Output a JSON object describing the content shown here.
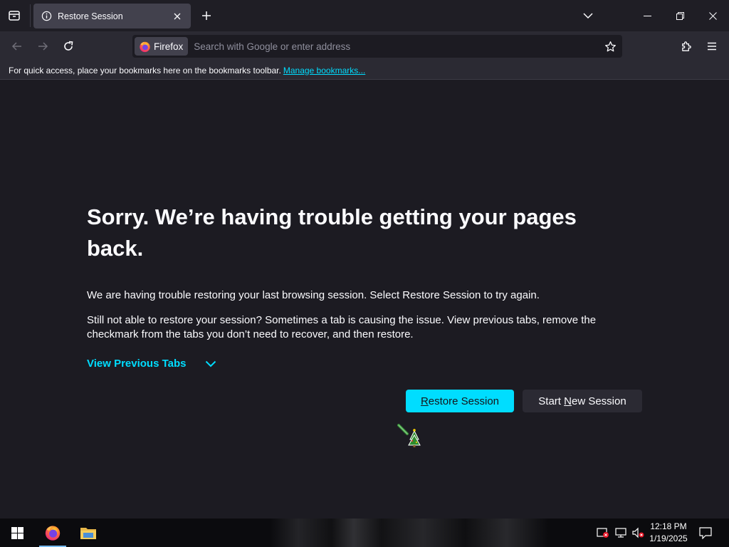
{
  "tab": {
    "title": "Restore Session",
    "icon": "info-icon"
  },
  "navbar": {
    "identity_label": "Firefox",
    "url_placeholder": "Search with Google or enter address",
    "url_value": ""
  },
  "bookmarks_bar": {
    "text": "For quick access, place your bookmarks here on the bookmarks toolbar.",
    "link": "Manage bookmarks..."
  },
  "page": {
    "heading": "Sorry. We’re having trouble getting your pages back.",
    "paragraph1": "We are having trouble restoring your last browsing session. Select Restore Session to try again.",
    "paragraph2": "Still not able to restore your session? Sometimes a tab is causing the issue. View previous tabs, remove the checkmark from the tabs you don’t need to recover, and then restore.",
    "view_previous_tabs": "View Previous Tabs",
    "restore_button": {
      "accesskey": "R",
      "rest": "estore Session"
    },
    "new_session_button": {
      "before": "Start ",
      "accesskey": "N",
      "after": "ew Session"
    }
  },
  "taskbar": {
    "time": "12:18 PM",
    "date": "1/19/2025"
  },
  "colors": {
    "accent": "#00ddff",
    "background": "#1c1b22",
    "toolbar": "#2b2a33",
    "tab_selected": "#42414d"
  }
}
